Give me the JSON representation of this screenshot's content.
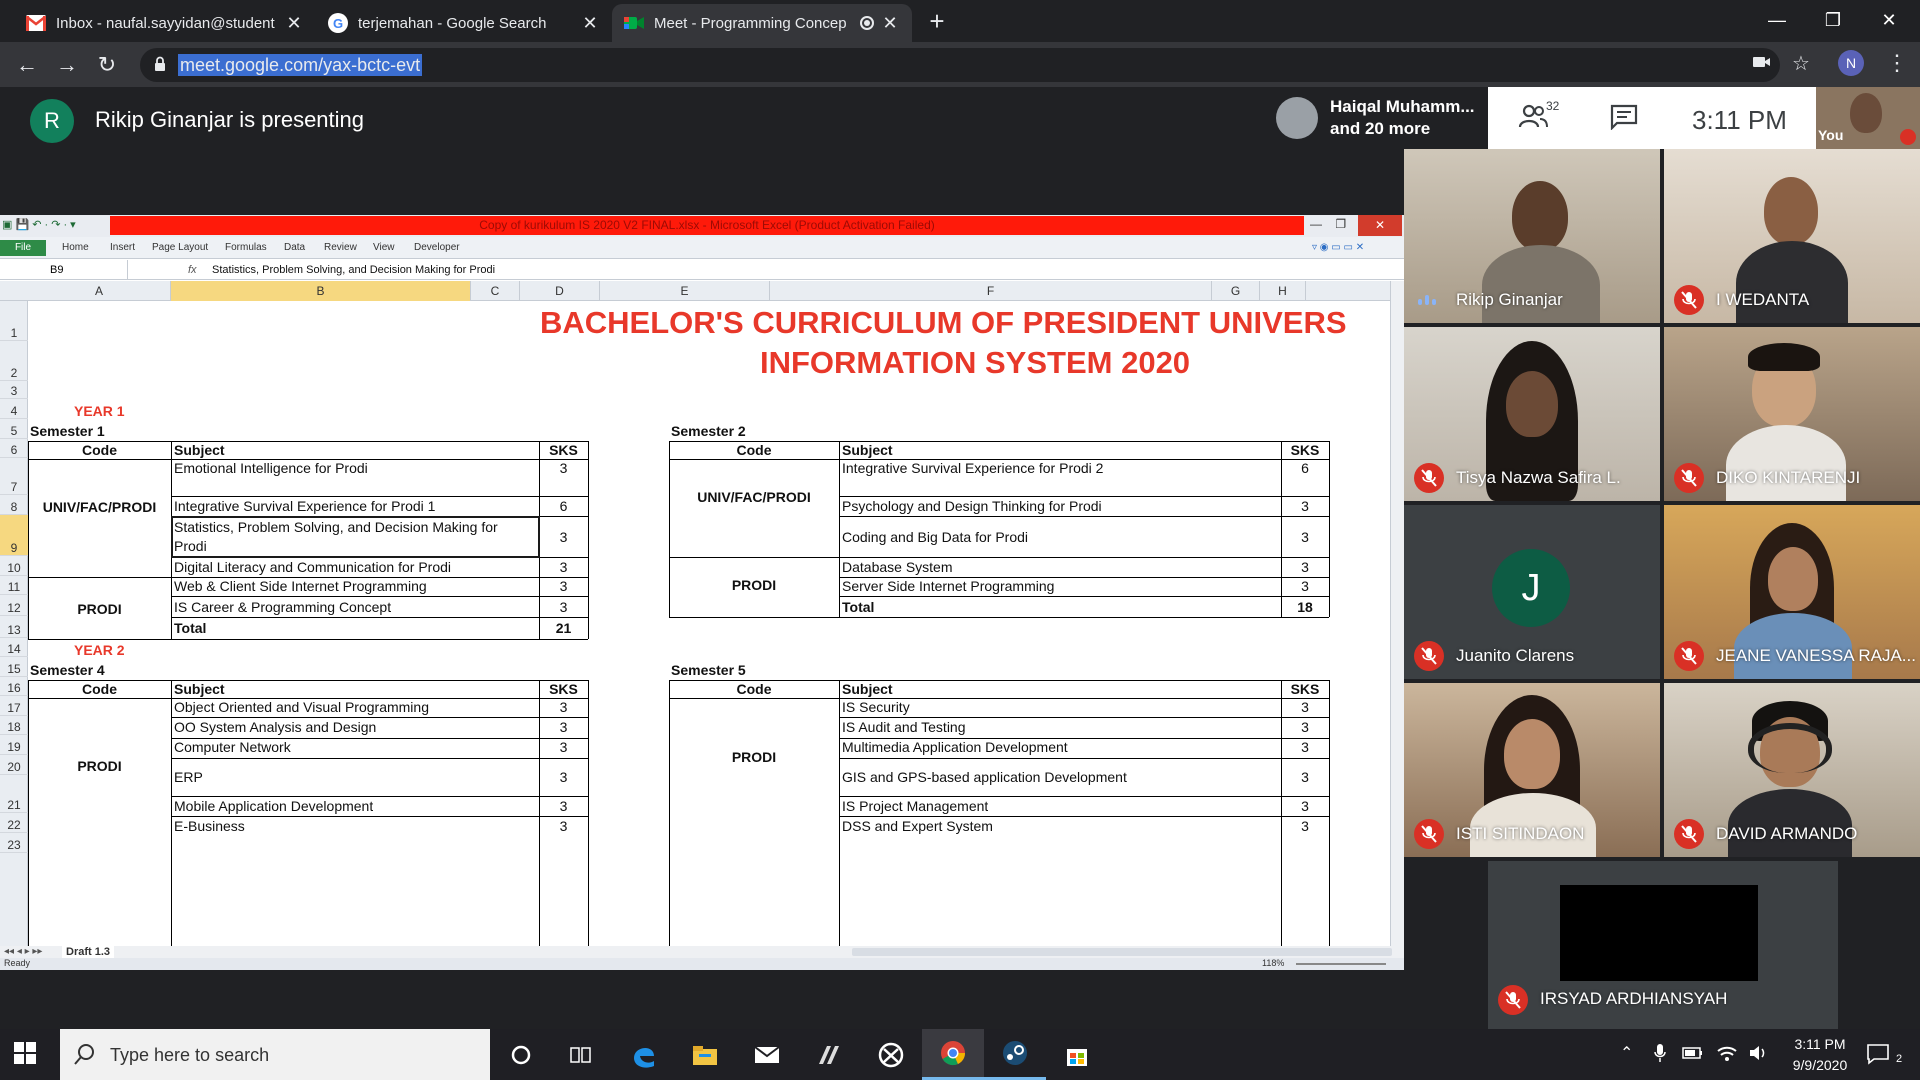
{
  "browser": {
    "tabs": [
      {
        "title": "Inbox - naufal.sayyidan@student",
        "favicon": "gmail-icon",
        "active": false
      },
      {
        "title": "terjemahan - Google Search",
        "favicon": "google-icon",
        "active": false
      },
      {
        "title": "Meet - Programming Concep",
        "favicon": "meet-icon",
        "active": true
      }
    ],
    "url": "meet.google.com/yax-bctc-evt",
    "profile_initial": "N"
  },
  "meet": {
    "presenter_initial": "R",
    "presenting_text": "Rikip Ginanjar is presenting",
    "participants_chip_line1": "Haiqal Muhamm...",
    "participants_chip_line2": "and 20 more",
    "participant_count": "32",
    "time": "3:11 PM",
    "self_label": "You",
    "participants": [
      {
        "name": "Rikip Ginanjar",
        "muted": false,
        "speaking": true
      },
      {
        "name": "I WEDANTA",
        "muted": true
      },
      {
        "name": "Tisya Nazwa Safira L.",
        "muted": true
      },
      {
        "name": "DIKO KINTARENJI",
        "muted": true
      },
      {
        "name": "Juanito Clarens",
        "muted": true,
        "initial": "J"
      },
      {
        "name": "JEANE VANESSA RAJA...",
        "muted": true
      },
      {
        "name": "ISTI SITINDAON",
        "muted": true
      },
      {
        "name": "DAVID ARMANDO",
        "muted": true
      },
      {
        "name": "IRSYAD ARDHIANSYAH",
        "muted": true
      }
    ]
  },
  "excel": {
    "window_title": "Copy of kurikulum IS 2020 V2 FINAL.xlsx - Microsoft Excel (Product Activation Failed)",
    "ribbon_tabs": [
      "File",
      "Home",
      "Insert",
      "Page Layout",
      "Formulas",
      "Data",
      "Review",
      "View",
      "Developer"
    ],
    "name_box": "B9",
    "fx": "fx",
    "formula": "Statistics, Problem Solving, and Decision Making for Prodi",
    "columns": [
      "A",
      "B",
      "C",
      "D",
      "E",
      "F",
      "G",
      "H"
    ],
    "selected_column": "B",
    "rows": [
      "1",
      "2",
      "3",
      "4",
      "5",
      "6",
      "7",
      "8",
      "9",
      "10",
      "11",
      "12",
      "13",
      "14",
      "15",
      "16",
      "17",
      "18",
      "19",
      "20",
      "21",
      "22",
      "23"
    ],
    "selected_row": "9",
    "title_line1": "BACHELOR'S CURRICULUM OF PRESIDENT UNIVERS",
    "title_line2": "INFORMATION SYSTEM 2020",
    "year1": "YEAR 1",
    "year2": "YEAR 2",
    "hdr_code": "Code",
    "hdr_subject": "Subject",
    "hdr_sks": "SKS",
    "total_label": "Total",
    "sem1": {
      "label": "Semester 1",
      "group1": "UNIV/FAC/PRODI",
      "group2": "PRODI",
      "subjects": [
        {
          "name": "Emotional Intelligence for Prodi",
          "sks": "3"
        },
        {
          "name": "Integrative Survival Experience for Prodi 1",
          "sks": "6"
        },
        {
          "name": "Statistics, Problem Solving, and Decision Making for",
          "name2": "Prodi",
          "sks": "3"
        },
        {
          "name": "Digital Literacy and Communication for Prodi",
          "sks": "3"
        },
        {
          "name": "Web & Client Side Internet Programming",
          "sks": "3"
        },
        {
          "name": "IS Career & Programming Concept",
          "sks": "3"
        }
      ],
      "total": "21"
    },
    "sem2": {
      "label": "Semester 2",
      "group1": "UNIV/FAC/PRODI",
      "group2": "PRODI",
      "subjects": [
        {
          "name": "Integrative Survival Experience for Prodi 2",
          "sks": "6"
        },
        {
          "name": "Psychology and Design Thinking for Prodi",
          "sks": "3"
        },
        {
          "name": "Coding and Big Data for Prodi",
          "sks": "3"
        },
        {
          "name": "Database System",
          "sks": "3"
        },
        {
          "name": "Server Side Internet Programming",
          "sks": "3"
        }
      ],
      "total": "18"
    },
    "sem4": {
      "label": "Semester 4",
      "group": "PRODI",
      "subjects": [
        {
          "name": "Object Oriented and Visual  Programming",
          "sks": "3"
        },
        {
          "name": "OO System Analysis and Design",
          "sks": "3"
        },
        {
          "name": "Computer Network",
          "sks": "3"
        },
        {
          "name": "ERP",
          "sks": "3"
        },
        {
          "name": "Mobile Application Development",
          "sks": "3"
        },
        {
          "name": "E-Business",
          "sks": "3"
        }
      ]
    },
    "sem5": {
      "label": "Semester 5",
      "group": "PRODI",
      "subjects": [
        {
          "name": "IS Security",
          "sks": "3"
        },
        {
          "name": "IS Audit and Testing",
          "sks": "3"
        },
        {
          "name": "Multimedia Application Development",
          "sks": "3"
        },
        {
          "name": "GIS and GPS-based application Development",
          "sks": "3"
        },
        {
          "name": "IS Project Management",
          "sks": "3"
        },
        {
          "name": "DSS and Expert System",
          "sks": "3"
        }
      ]
    },
    "sheet_name": "Draft 1.3",
    "status": "Ready",
    "zoom": "118%"
  },
  "taskbar": {
    "search_placeholder": "Type here to search",
    "time": "3:11 PM",
    "date": "9/9/2020",
    "notification_count": "2"
  },
  "colors": {
    "meet_green": "#12805c",
    "mute_red": "#d93025",
    "excel_red_bar": "#ff1a0a",
    "title_red": "#e8382a",
    "selection_yellow": "#f6d880"
  }
}
